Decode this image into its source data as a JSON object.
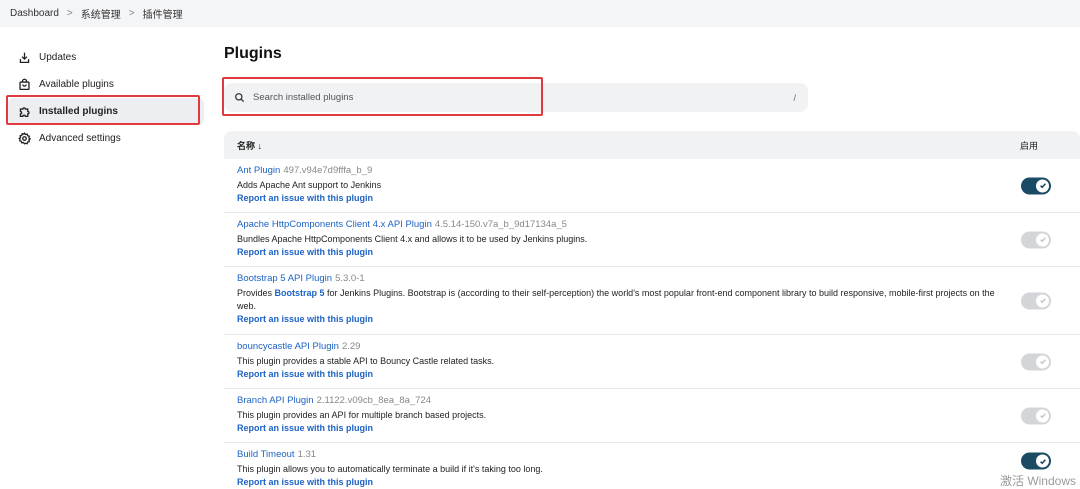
{
  "breadcrumb": {
    "items": [
      "Dashboard",
      "系统管理",
      "插件管理"
    ],
    "separator": ">"
  },
  "sidebar": {
    "items": [
      {
        "label": "Updates",
        "icon": "download-icon"
      },
      {
        "label": "Available plugins",
        "icon": "shopping-bag-icon"
      },
      {
        "label": "Installed plugins",
        "icon": "puzzle-icon"
      },
      {
        "label": "Advanced settings",
        "icon": "gear-icon"
      }
    ]
  },
  "main": {
    "title": "Plugins",
    "search": {
      "placeholder": "Search installed plugins",
      "shortcut": "/"
    },
    "table": {
      "col_name": "名称 ↓",
      "col_enabled": "启用",
      "rows": [
        {
          "name": "Ant Plugin",
          "version": "497.v94e7d9fffa_b_9",
          "desc": "Adds Apache Ant support to Jenkins",
          "report": "Report an issue with this plugin",
          "enabled": true
        },
        {
          "name": "Apache HttpComponents Client 4.x API Plugin",
          "version": "4.5.14-150.v7a_b_9d17134a_5",
          "desc": "Bundles Apache HttpComponents Client 4.x and allows it to be used by Jenkins plugins.",
          "report": "Report an issue with this plugin",
          "enabled": false
        },
        {
          "name": "Bootstrap 5 API Plugin",
          "version": "5.3.0-1",
          "desc_prefix": "Provides ",
          "desc_strong": "Bootstrap 5",
          "desc_suffix": " for Jenkins Plugins. Bootstrap is (according to their self-perception) the world's most popular front-end component library to build responsive, mobile-first projects on the web.",
          "report": "Report an issue with this plugin",
          "enabled": false
        },
        {
          "name": "bouncycastle API Plugin",
          "version": "2.29",
          "desc": "This plugin provides a stable API to Bouncy Castle related tasks.",
          "report": "Report an issue with this plugin",
          "enabled": false
        },
        {
          "name": "Branch API Plugin",
          "version": "2.1122.v09cb_8ea_8a_724",
          "desc": "This plugin provides an API for multiple branch based projects.",
          "report": "Report an issue with this plugin",
          "enabled": false
        },
        {
          "name": "Build Timeout",
          "version": "1.31",
          "desc": "This plugin allows you to automatically terminate a build if it's taking too long.",
          "report": "Report an issue with this plugin",
          "enabled": true
        }
      ]
    }
  },
  "watermark": "激活 Windows",
  "colors": {
    "link": "#1d63c4",
    "toggle_on": "#1b4a64",
    "toggle_off": "#d3d5d8",
    "highlight": "#e0393e"
  }
}
